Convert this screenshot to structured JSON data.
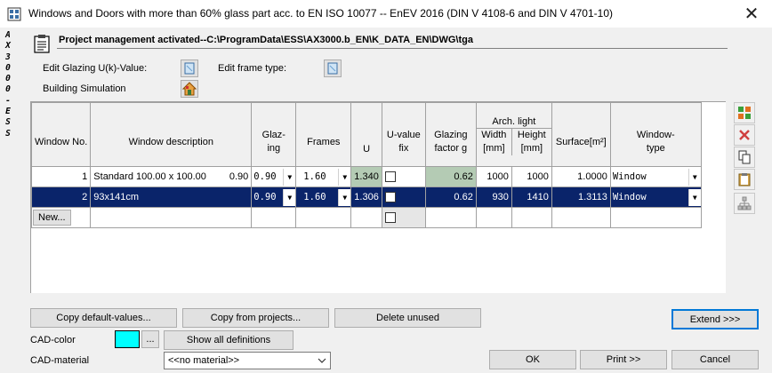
{
  "window": {
    "title": "Windows and Doors with more than 60% glass part acc. to EN ISO 10077 -- EnEV 2016 (DIN V 4108-6 and DIN V 4701-10)",
    "close_glyph": "✕"
  },
  "side_label": [
    "A",
    "X",
    "3",
    "0",
    "0",
    "0",
    " ",
    "-",
    " ",
    "E",
    "S",
    "S"
  ],
  "project": {
    "title": "Project management activated--C:\\ProgramData\\ESS\\AX3000.b_EN\\K_DATA_EN\\DWG\\tga"
  },
  "options": {
    "edit_glazing_label": "Edit Glazing U(k)-Value:",
    "edit_frame_label": "Edit frame type:",
    "building_sim_label": "Building Simulation"
  },
  "table": {
    "group_header": "Arch. light",
    "headers": {
      "window_no": "Window No.",
      "description": "Window description",
      "glazing": "Glaz-ing",
      "frames": "Frames",
      "u": "U",
      "u_fix": "U-value fix",
      "glazing_factor": "Glazing factor g",
      "width": "Width [mm]",
      "height": "Height [mm]",
      "surface": "Surface[m²]",
      "window_type": "Window-type"
    },
    "rows": [
      {
        "no": "1",
        "description": "Standard 100.00 x 100.00",
        "desc_value": "0.90",
        "glazing": "0.90",
        "frames": "1.60",
        "u": "1.340",
        "g": "0.62",
        "width": "1000",
        "height": "1000",
        "surface": "1.0000",
        "type": "Window"
      },
      {
        "no": "2",
        "description": "93x141cm",
        "desc_value": "",
        "glazing": "0.90",
        "frames": "1.60",
        "u": "1.306",
        "g": "0.62",
        "width": "930",
        "height": "1410",
        "surface": "1.3113",
        "type": "Window"
      }
    ],
    "new_label": "New..."
  },
  "buttons": {
    "copy_defaults": "Copy default-values...",
    "copy_projects": "Copy from projects...",
    "delete_unused": "Delete unused",
    "extend": "Extend >>>",
    "show_all": "Show all definitions",
    "ellipsis": "...",
    "ok": "OK",
    "print": "Print >>",
    "cancel": "Cancel"
  },
  "cad": {
    "color_label": "CAD-color",
    "color_value": "#00ffff",
    "material_label": "CAD-material",
    "material_value": "<<no material>>"
  }
}
